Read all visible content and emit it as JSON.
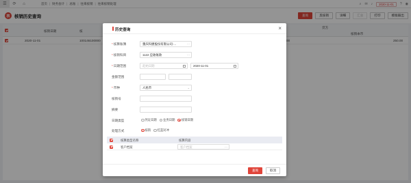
{
  "topbar": {
    "breadcrumbs": [
      "首页",
      "财务会计",
      "总账",
      "往来核销",
      "往来核销处理"
    ],
    "date": "2020-11-01",
    "icons": [
      "menu-icon",
      "refresh-icon",
      "message-icon",
      "bell-icon",
      "help-icon",
      "user-icon"
    ]
  },
  "page": {
    "logo": "核",
    "title": "核销历史查询",
    "buttons": [
      "查询",
      "反核销",
      "详细",
      "汇总",
      "打印",
      "模板输出"
    ]
  },
  "table": {
    "headers": {
      "date": "核销日期",
      "col2": "核",
      "credit": "贷方",
      "amount": "核销本币"
    },
    "row": {
      "date": "2020-11-01",
      "voucher": "100146100000",
      "val1": "00",
      "val2": "250.00"
    }
  },
  "modal": {
    "title": "历史查询",
    "fields": {
      "book": {
        "label": "核算账簿",
        "value": "重庆科捷股份有限公司-..."
      },
      "subject": {
        "label": "核销科目",
        "value": "1122 应收账款"
      },
      "daterange": {
        "label": "日期范围",
        "start_placeholder": "起始日期",
        "end": "2020-11-01"
      },
      "amount": {
        "label": "金额范围"
      },
      "currency": {
        "label": "币种",
        "value": "人民币"
      },
      "verifyno": {
        "label": "核销号"
      },
      "summary": {
        "label": "摘要"
      },
      "datetype": {
        "label": "日期类型",
        "options": [
          "凭证日期",
          "业务日期",
          "核销日期"
        ],
        "selected": 2
      },
      "method": {
        "label": "处理方式",
        "options": [
          "核销",
          "红蓝对冲"
        ],
        "selected": 0
      }
    },
    "subtable": {
      "headers": [
        "核算类型名称",
        "核算内容"
      ],
      "rows": [
        {
          "type": "客户档案",
          "placeholder": "客户档案"
        }
      ]
    },
    "footer": {
      "query": "查询",
      "cancel": "取消"
    }
  },
  "colors": {
    "accent": "#e0453a",
    "overlay": "rgba(0,0,0,0.42)"
  }
}
